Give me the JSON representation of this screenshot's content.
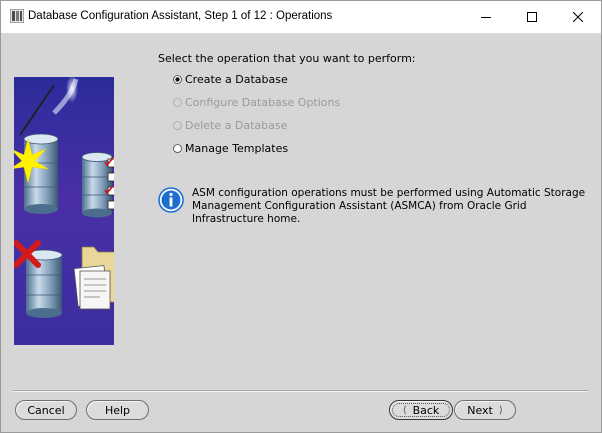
{
  "window": {
    "title": "Database Configuration Assistant, Step 1 of 12 : Operations"
  },
  "main": {
    "prompt": "Select the operation that you want to perform:",
    "options": [
      {
        "label": "Create a Database",
        "selected": true,
        "enabled": true
      },
      {
        "label": "Configure Database Options",
        "selected": false,
        "enabled": false
      },
      {
        "label": "Delete a Database",
        "selected": false,
        "enabled": false
      },
      {
        "label": "Manage Templates",
        "selected": false,
        "enabled": true
      }
    ],
    "info": {
      "line1": "ASM configuration operations must be performed using Automatic Storage",
      "line2": "Management Configuration Assistant (ASMCA) from Oracle Grid Infrastructure home."
    }
  },
  "footer": {
    "cancel_label": "Cancel",
    "help_label": "Help",
    "back_label": "Back",
    "next_label": "Next"
  },
  "colors": {
    "accent_blue": "#1f6fd1",
    "panel_purple": "#3a2ea0",
    "error_red": "#d21a1a"
  }
}
